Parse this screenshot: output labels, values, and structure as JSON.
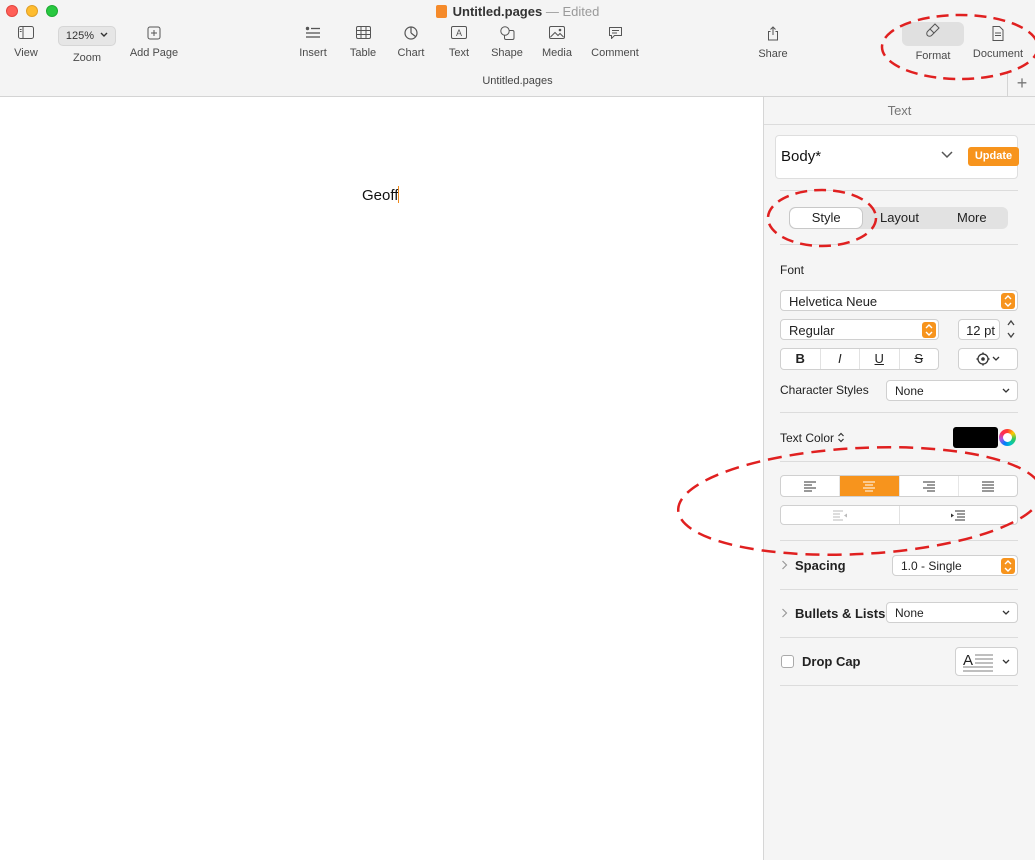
{
  "window": {
    "file_name": "Untitled.pages",
    "separator": "—",
    "status": "Edited",
    "subtitle": "Untitled.pages"
  },
  "toolbar": {
    "view_label": "View",
    "zoom_value": "125%",
    "zoom_label": "Zoom",
    "add_page_label": "Add Page",
    "insert_label": "Insert",
    "table_label": "Table",
    "chart_label": "Chart",
    "text_label": "Text",
    "shape_label": "Shape",
    "media_label": "Media",
    "comment_label": "Comment",
    "share_label": "Share",
    "format_label": "Format",
    "document_label": "Document",
    "add_tab_symbol": "+"
  },
  "document": {
    "body_text": "Geoff"
  },
  "sidebar": {
    "header": "Text",
    "paragraph_style": "Body*",
    "update_label": "Update",
    "tabs": [
      "Style",
      "Layout",
      "More"
    ],
    "active_tab": "Style",
    "font_section_label": "Font",
    "font_family": "Helvetica Neue",
    "font_style": "Regular",
    "font_size": "12 pt",
    "format_buttons": [
      "B",
      "I",
      "U",
      "S"
    ],
    "character_styles_label": "Character Styles",
    "character_styles_value": "None",
    "text_color_label": "Text Color",
    "text_color": "#000000",
    "alignment_selected": "center",
    "spacing_label": "Spacing",
    "spacing_value": "1.0 - Single",
    "bullets_label": "Bullets & Lists",
    "bullets_value": "None",
    "drop_cap_label": "Drop Cap",
    "drop_cap_checked": false
  },
  "colors": {
    "accent": "#f7941d",
    "annotation": "#e02020"
  }
}
